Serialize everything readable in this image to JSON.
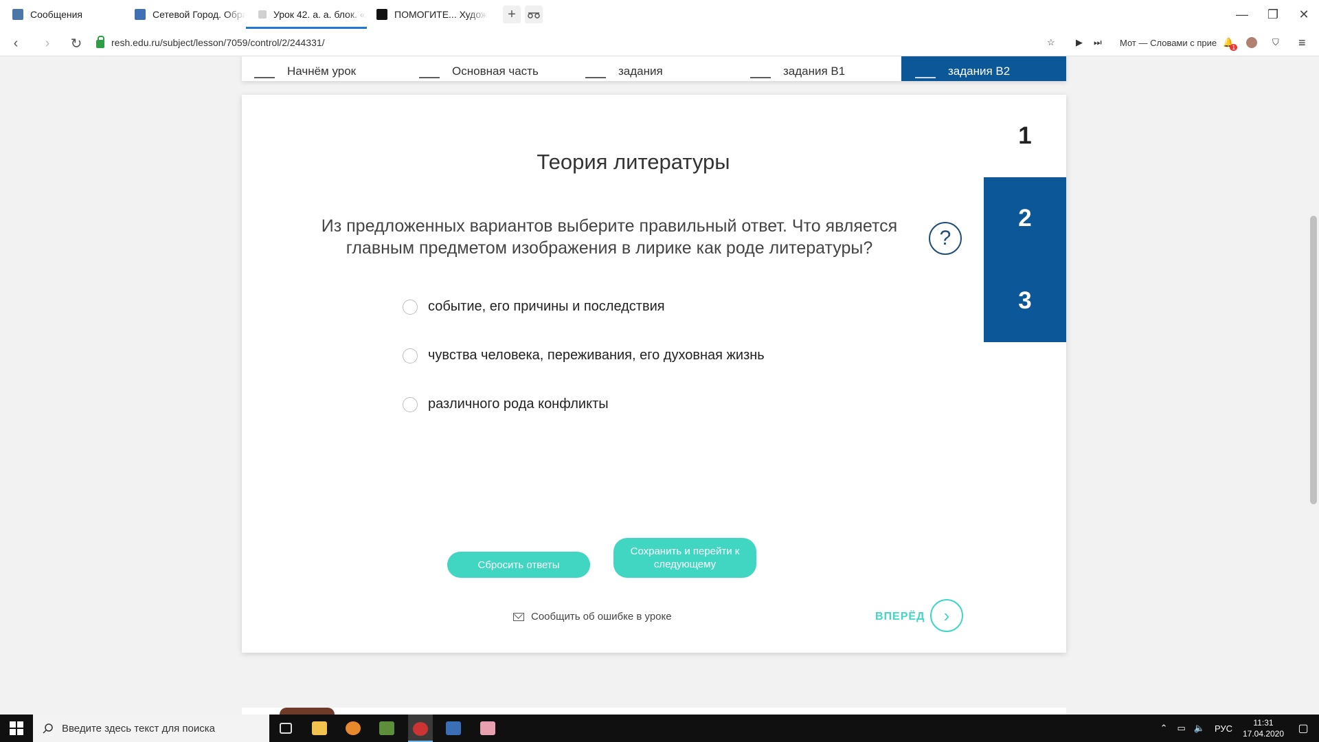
{
  "browser": {
    "tabs": [
      {
        "title": "Сообщения",
        "color": "#4a76a8"
      },
      {
        "title": "Сетевой Город. Образ",
        "color": "#3f6fb5"
      },
      {
        "title": "Урок 42. а. а. блок. «ле",
        "color": "#8a8a8a"
      },
      {
        "title": "ПОМОГИТЕ... Художес",
        "color": "#111111"
      }
    ],
    "url": "resh.edu.ru/subject/lesson/7059/control/2/244331/",
    "media_title": "Мот — Словами с прие",
    "notification_count": "1"
  },
  "steps": [
    {
      "label": "Начнём урок"
    },
    {
      "label": "Основная часть"
    },
    {
      "label": "задания"
    },
    {
      "label": "задания В1"
    },
    {
      "label": "задания В2"
    }
  ],
  "quiz": {
    "title": "Теория литературы",
    "question": "Из предложенных вариантов выберите правильный ответ. Что является главным предметом изображения в лирике как роде литературы?",
    "help_symbol": "?",
    "options": [
      {
        "text": "событие, его причины и последствия"
      },
      {
        "text": "чувства человека, переживания, его духовная жизнь"
      },
      {
        "text": "различного рода конфликты"
      }
    ],
    "question_nav": [
      {
        "num": "1"
      },
      {
        "num": "2"
      },
      {
        "num": "3"
      }
    ],
    "reset_label": "Сбросить ответы",
    "save_label": "Сохранить и перейти к следующему",
    "report_label": "Сообщить об ошибке в уроке",
    "forward_label": "ВПЕРЁД"
  },
  "colors": {
    "accent": "#40d6c2",
    "nav_blue": "#0b5797"
  },
  "taskbar": {
    "search_placeholder": "Введите здесь текст для поиска",
    "language": "РУС",
    "time": "11:31",
    "date": "17.04.2020"
  }
}
